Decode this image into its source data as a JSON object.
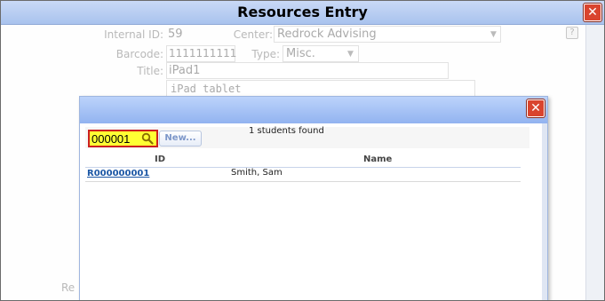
{
  "window": {
    "title": "Resources Entry",
    "close_symbol": "✕"
  },
  "form": {
    "internal_id_label": "Internal ID:",
    "internal_id_value": "59",
    "center_label": "Center:",
    "center_value": "Redrock Advising",
    "barcode_label": "Barcode:",
    "barcode_value": "1111111111",
    "type_label": "Type:",
    "type_value": "Misc.",
    "title_label": "Title:",
    "title_value": "iPad1",
    "description_value": "iPad tablet",
    "hidden_label_fragment": "Re",
    "help_symbol": "?"
  },
  "modal": {
    "close_symbol": "✕",
    "search_value": "000001",
    "new_button_label": "New...",
    "result_count": "1 students found",
    "columns": [
      "ID",
      "Name"
    ],
    "rows": [
      {
        "id": "R000000001",
        "name": "Smith, Sam"
      }
    ]
  },
  "colors": {
    "title_bar": "#a9c3ee",
    "modal_bar": "#92b3f0",
    "close_button": "#d9442e",
    "search_highlight": "#ffff33",
    "search_border": "#cc1f1f",
    "link": "#1c57a5"
  }
}
